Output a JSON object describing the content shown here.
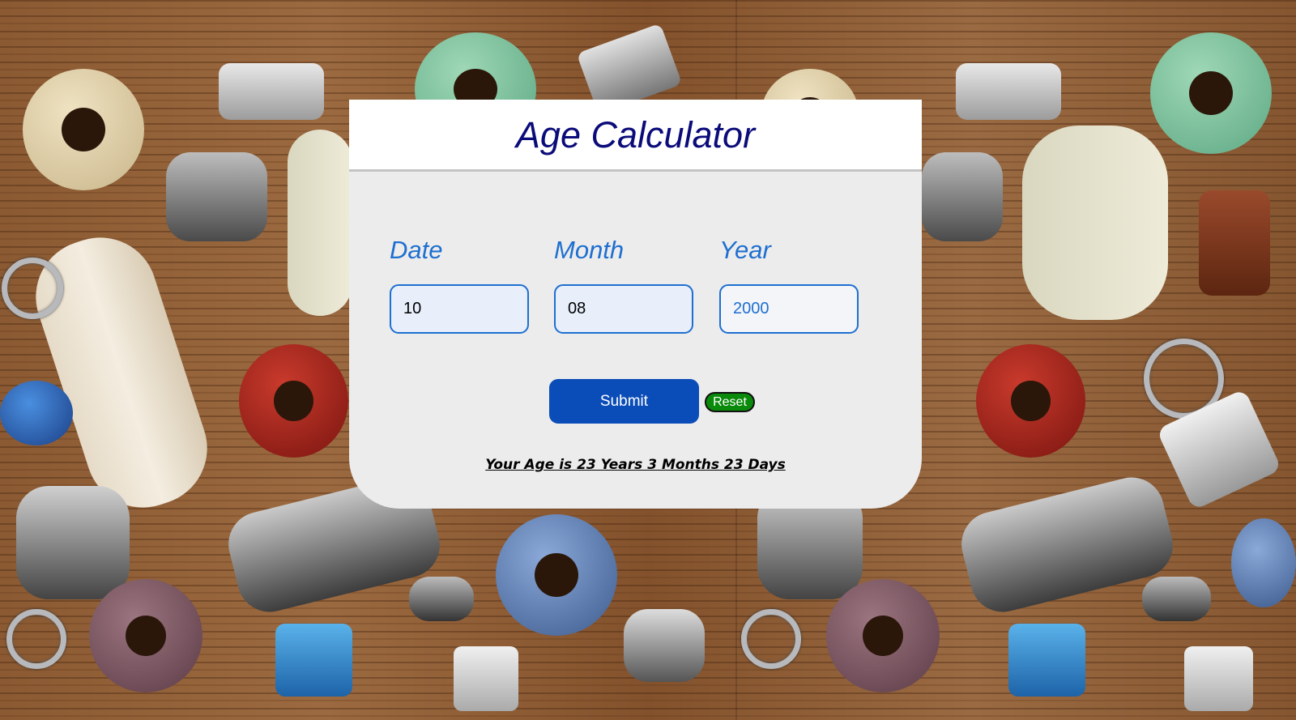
{
  "app": {
    "title": "Age Calculator"
  },
  "form": {
    "date": {
      "label": "Date",
      "value": "10",
      "placeholder": ""
    },
    "month": {
      "label": "Month",
      "value": "08",
      "placeholder": ""
    },
    "year": {
      "label": "Year",
      "value": "",
      "placeholder": "2000"
    },
    "submit_label": "Submit",
    "reset_label": "Reset"
  },
  "result": {
    "text": "Your Age is 23 Years 3 Months 23 Days"
  },
  "colors": {
    "title": "#0b0b7a",
    "label": "#1e6fd0",
    "submit": "#0b4db8",
    "reset": "#0a8a0a",
    "card": "#ececec"
  },
  "background": {
    "image": "wooden-table-with-beads"
  }
}
